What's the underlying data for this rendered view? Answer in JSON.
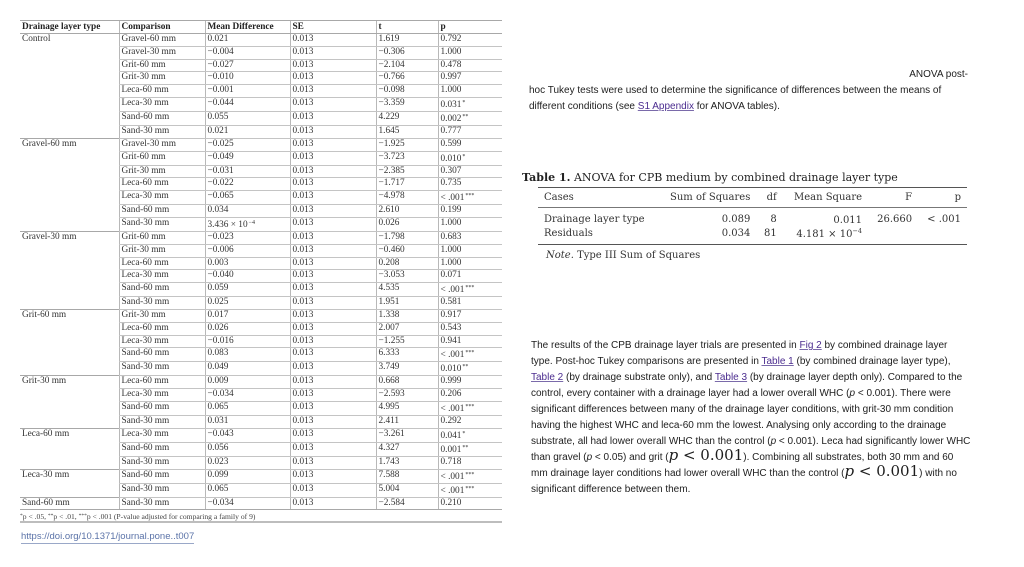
{
  "tukey_table": {
    "headers": [
      "Drainage layer type",
      "Comparison",
      "Mean Difference",
      "SE",
      "t",
      "p"
    ],
    "groups": [
      {
        "type": "Control",
        "rows": [
          {
            "comparison": "Gravel-60 mm",
            "mean_diff": "0.021",
            "se": "0.013",
            "t": "1.619",
            "p": "0.792",
            "sig": ""
          },
          {
            "comparison": "Gravel-30 mm",
            "mean_diff": "−0.004",
            "se": "0.013",
            "t": "−0.306",
            "p": "1.000",
            "sig": ""
          },
          {
            "comparison": "Grit-60 mm",
            "mean_diff": "−0.027",
            "se": "0.013",
            "t": "−2.104",
            "p": "0.478",
            "sig": ""
          },
          {
            "comparison": "Grit-30 mm",
            "mean_diff": "−0.010",
            "se": "0.013",
            "t": "−0.766",
            "p": "0.997",
            "sig": ""
          },
          {
            "comparison": "Leca-60 mm",
            "mean_diff": "−0.001",
            "se": "0.013",
            "t": "−0.098",
            "p": "1.000",
            "sig": ""
          },
          {
            "comparison": "Leca-30 mm",
            "mean_diff": "−0.044",
            "se": "0.013",
            "t": "−3.359",
            "p": "0.031",
            "sig": "*"
          },
          {
            "comparison": "Sand-60 mm",
            "mean_diff": "0.055",
            "se": "0.013",
            "t": "4.229",
            "p": "0.002",
            "sig": "**"
          },
          {
            "comparison": "Sand-30 mm",
            "mean_diff": "0.021",
            "se": "0.013",
            "t": "1.645",
            "p": "0.777",
            "sig": ""
          }
        ]
      },
      {
        "type": "Gravel-60 mm",
        "rows": [
          {
            "comparison": "Gravel-30 mm",
            "mean_diff": "−0.025",
            "se": "0.013",
            "t": "−1.925",
            "p": "0.599",
            "sig": ""
          },
          {
            "comparison": "Grit-60 mm",
            "mean_diff": "−0.049",
            "se": "0.013",
            "t": "−3.723",
            "p": "0.010",
            "sig": "*"
          },
          {
            "comparison": "Grit-30 mm",
            "mean_diff": "−0.031",
            "se": "0.013",
            "t": "−2.385",
            "p": "0.307",
            "sig": ""
          },
          {
            "comparison": "Leca-60 mm",
            "mean_diff": "−0.022",
            "se": "0.013",
            "t": "−1.717",
            "p": "0.735",
            "sig": ""
          },
          {
            "comparison": "Leca-30 mm",
            "mean_diff": "−0.065",
            "se": "0.013",
            "t": "−4.978",
            "p": "< .001",
            "sig": "***"
          },
          {
            "comparison": "Sand-60 mm",
            "mean_diff": "0.034",
            "se": "0.013",
            "t": "2.610",
            "p": "0.199",
            "sig": ""
          },
          {
            "comparison": "Sand-30 mm",
            "mean_diff": "3.436 × 10",
            "mean_diff_exp": "−4",
            "se": "0.013",
            "t": "0.026",
            "p": "1.000",
            "sig": ""
          }
        ]
      },
      {
        "type": "Gravel-30 mm",
        "rows": [
          {
            "comparison": "Grit-60 mm",
            "mean_diff": "−0.023",
            "se": "0.013",
            "t": "−1.798",
            "p": "0.683",
            "sig": ""
          },
          {
            "comparison": "Grit-30 mm",
            "mean_diff": "−0.006",
            "se": "0.013",
            "t": "−0.460",
            "p": "1.000",
            "sig": ""
          },
          {
            "comparison": "Leca-60 mm",
            "mean_diff": "0.003",
            "se": "0.013",
            "t": "0.208",
            "p": "1.000",
            "sig": ""
          },
          {
            "comparison": "Leca-30 mm",
            "mean_diff": "−0.040",
            "se": "0.013",
            "t": "−3.053",
            "p": "0.071",
            "sig": ""
          },
          {
            "comparison": "Sand-60 mm",
            "mean_diff": "0.059",
            "se": "0.013",
            "t": "4.535",
            "p": "< .001",
            "sig": "***"
          },
          {
            "comparison": "Sand-30 mm",
            "mean_diff": "0.025",
            "se": "0.013",
            "t": "1.951",
            "p": "0.581",
            "sig": ""
          }
        ]
      },
      {
        "type": "Grit-60 mm",
        "rows": [
          {
            "comparison": "Grit-30 mm",
            "mean_diff": "0.017",
            "se": "0.013",
            "t": "1.338",
            "p": "0.917",
            "sig": ""
          },
          {
            "comparison": "Leca-60 mm",
            "mean_diff": "0.026",
            "se": "0.013",
            "t": "2.007",
            "p": "0.543",
            "sig": ""
          },
          {
            "comparison": "Leca-30 mm",
            "mean_diff": "−0.016",
            "se": "0.013",
            "t": "−1.255",
            "p": "0.941",
            "sig": ""
          },
          {
            "comparison": "Sand-60 mm",
            "mean_diff": "0.083",
            "se": "0.013",
            "t": "6.333",
            "p": "< .001",
            "sig": "***"
          },
          {
            "comparison": "Sand-30 mm",
            "mean_diff": "0.049",
            "se": "0.013",
            "t": "3.749",
            "p": "0.010",
            "sig": "**"
          }
        ]
      },
      {
        "type": "Grit-30 mm",
        "rows": [
          {
            "comparison": "Leca-60 mm",
            "mean_diff": "0.009",
            "se": "0.013",
            "t": "0.668",
            "p": "0.999",
            "sig": ""
          },
          {
            "comparison": "Leca-30 mm",
            "mean_diff": "−0.034",
            "se": "0.013",
            "t": "−2.593",
            "p": "0.206",
            "sig": ""
          },
          {
            "comparison": "Sand-60 mm",
            "mean_diff": "0.065",
            "se": "0.013",
            "t": "4.995",
            "p": "< .001",
            "sig": "***"
          },
          {
            "comparison": "Sand-30 mm",
            "mean_diff": "0.031",
            "se": "0.013",
            "t": "2.411",
            "p": "0.292",
            "sig": ""
          }
        ]
      },
      {
        "type": "Leca-60 mm",
        "rows": [
          {
            "comparison": "Leca-30 mm",
            "mean_diff": "−0.043",
            "se": "0.013",
            "t": "−3.261",
            "p": "0.041",
            "sig": "*"
          },
          {
            "comparison": "Sand-60 mm",
            "mean_diff": "0.056",
            "se": "0.013",
            "t": "4.327",
            "p": "0.001",
            "sig": "**"
          },
          {
            "comparison": "Sand-30 mm",
            "mean_diff": "0.023",
            "se": "0.013",
            "t": "1.743",
            "p": "0.718",
            "sig": ""
          }
        ]
      },
      {
        "type": "Leca-30 mm",
        "rows": [
          {
            "comparison": "Sand-60 mm",
            "mean_diff": "0.099",
            "se": "0.013",
            "t": "7.588",
            "p": "< .001",
            "sig": "***"
          },
          {
            "comparison": "Sand-30 mm",
            "mean_diff": "0.065",
            "se": "0.013",
            "t": "5.004",
            "p": "< .001",
            "sig": "***"
          }
        ]
      },
      {
        "type": "Sand-60 mm",
        "rows": [
          {
            "comparison": "Sand-30 mm",
            "mean_diff": "−0.034",
            "se": "0.013",
            "t": "−2.584",
            "p": "0.210",
            "sig": ""
          }
        ]
      }
    ],
    "footnote": {
      "s1": "*",
      "t1": "p < .05, ",
      "s2": "**",
      "t2": "p < .01, ",
      "s3": "***",
      "t3": "p < .001 (P-value adjusted for comparing a family of 9)"
    },
    "doi_link": "https://doi.org/10.1371/journal.pone..t007"
  },
  "paragraph1": {
    "line1": "ANOVA post-",
    "before_link": "hoc Tukey tests were used to determine the significance of differences between the means of different conditions (see ",
    "link": "S1 Appendix",
    "after_link": " for ANOVA tables)."
  },
  "anova_table": {
    "title_label": "Table 1.",
    "title_text": " ANOVA for CPB medium by combined drainage layer type",
    "headers": [
      "Cases",
      "Sum of Squares",
      "df",
      "Mean Square",
      "F",
      "p"
    ],
    "rows": [
      {
        "cases": "Drainage layer type",
        "ss": "0.089",
        "df": "8",
        "ms": "0.011",
        "ms_exp": "",
        "f": "26.660",
        "p": "< .001"
      },
      {
        "cases": "Residuals",
        "ss": "0.034",
        "df": "81",
        "ms": "4.181 × 10",
        "ms_exp": "−4",
        "f": "",
        "p": ""
      }
    ],
    "note_label": "Note.",
    "note_text": " Type III Sum of Squares"
  },
  "paragraph2": {
    "s1": "The results of the CPB drainage layer trials are presented in ",
    "link_fig2": "Fig 2",
    "s2": " by combined drainage layer type. Post-hoc Tukey comparisons are presented in ",
    "link_table1": "Table 1",
    "s3": " (by combined drainage layer type), ",
    "link_table2": "Table 2",
    "s4": " (by drainage substrate only), and ",
    "link_table3": "Table 3",
    "s5": " (by drainage layer depth only). Compared to the control, every container with a drainage layer had a lower overall WHC (",
    "p_var": "p",
    "s6": " < 0.001). There were significant differences between many of the drainage layer conditions, with grit-30 mm condition having the highest WHC and leca-60 mm the lowest. Analysing only according to the drainage substrate, all had lower overall WHC than the control (",
    "s7": " < 0.001). Leca had significantly lower WHC than gravel (",
    "s8": " < 0.05) and grit (",
    "math1": " < 0.001",
    "s9": "). Combining all substrates, both 30 mm and 60 mm drainage layer conditions had lower overall WHC than the control (",
    "math2": " < 0.001",
    "s10": ") with no significant difference between them."
  }
}
